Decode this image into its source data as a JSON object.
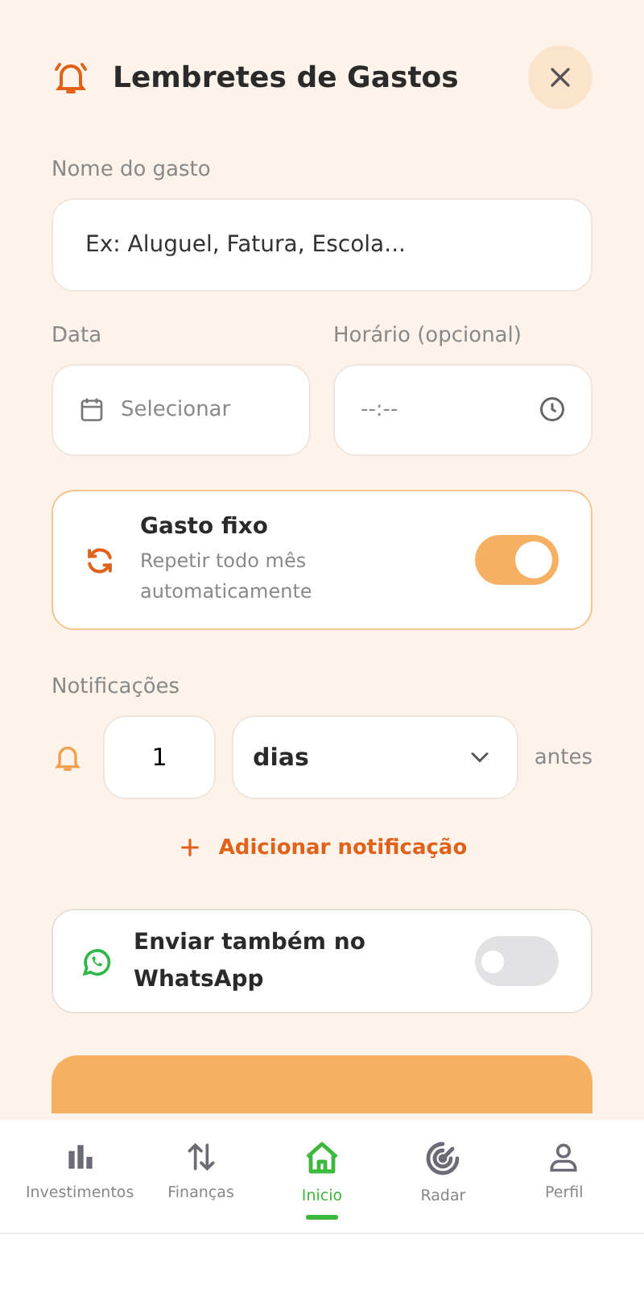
{
  "header": {
    "title": "Lembretes de Gastos"
  },
  "name_field": {
    "label": "Nome do gasto",
    "placeholder": "Ex: Aluguel, Fatura, Escola..."
  },
  "date_field": {
    "label": "Data",
    "placeholder": "Selecionar"
  },
  "time_field": {
    "label": "Horário (opcional)",
    "placeholder": "--:--"
  },
  "fixed_expense": {
    "title": "Gasto fixo",
    "subtitle": "Repetir todo mês automaticamente",
    "on": true
  },
  "notifications": {
    "label": "Notificações",
    "items": [
      {
        "amount": "1",
        "unit": "dias",
        "suffix": "antes"
      }
    ],
    "add_label": "Adicionar notificação"
  },
  "whatsapp": {
    "label": "Enviar também no WhatsApp",
    "on": false
  },
  "nav": [
    {
      "label": "Investimentos",
      "selected": false
    },
    {
      "label": "Finanças",
      "selected": false
    },
    {
      "label": "Inicio",
      "selected": true
    },
    {
      "label": "Radar",
      "selected": false
    },
    {
      "label": "Perfil",
      "selected": false
    }
  ]
}
